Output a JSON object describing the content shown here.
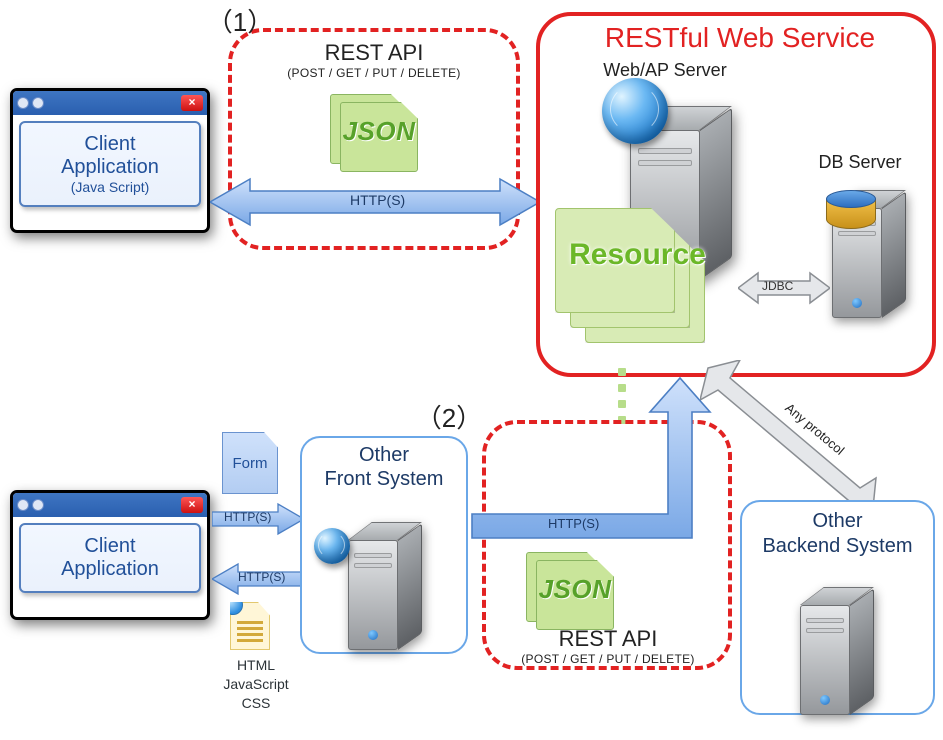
{
  "section1": {
    "num": "（1）",
    "title": "REST API",
    "sub": "(POST / GET / PUT / DELETE)",
    "json": "JSON",
    "proto": "HTTP(S)"
  },
  "section2": {
    "num": "（2）",
    "title": "REST API",
    "sub": "(POST / GET / PUT / DELETE)",
    "json": "JSON",
    "proto": "HTTP(S)"
  },
  "restful": {
    "title": "RESTful Web Service",
    "webap": "Web/AP Server",
    "resource": "Resource",
    "dbserver": "DB Server",
    "jdbc": "JDBC"
  },
  "client1": {
    "l1": "Client",
    "l2": "Application",
    "l3": "(Java Script)"
  },
  "client2": {
    "l1": "Client",
    "l2": "Application"
  },
  "form": {
    "label": "Form",
    "http1": "HTTP(S)",
    "http2": "HTTP(S)"
  },
  "htmldoc": {
    "lines": "HTML\nJavaScript\nCSS"
  },
  "front": {
    "title1": "Other",
    "title2": "Front System"
  },
  "backend": {
    "title1": "Other",
    "title2": "Backend System",
    "proto": "Any protocol"
  }
}
